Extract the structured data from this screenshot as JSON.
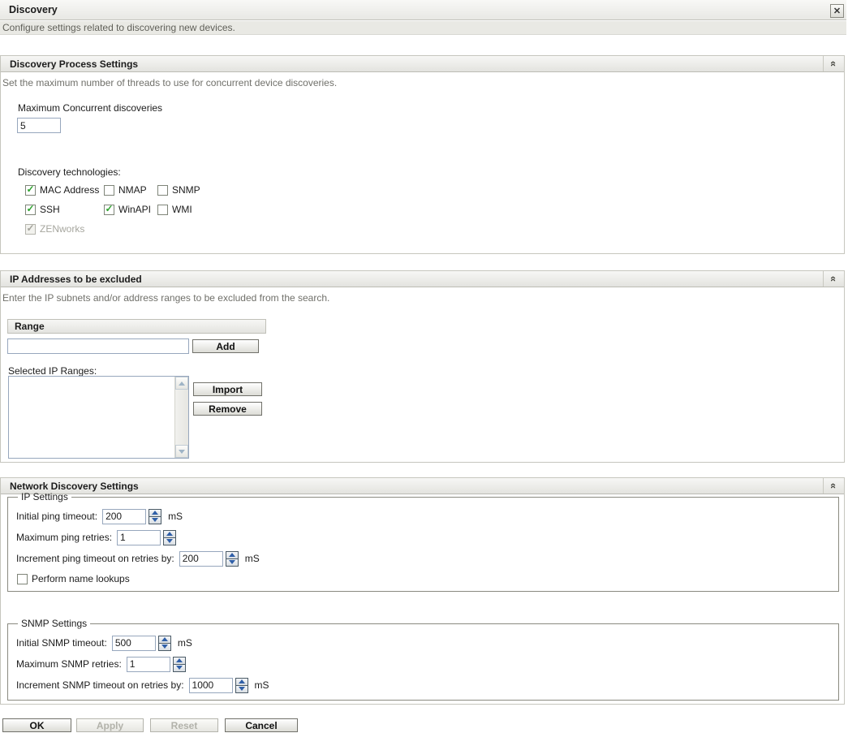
{
  "ui": {
    "check_glyph": "✓",
    "collapse_glyph": "«",
    "close_glyph": "✕"
  },
  "colors": {
    "check_green": "#2da32d",
    "spinner_blue": "#2f5fa8",
    "panel_header_bg": "#ececе8",
    "subtitle_bg": "#e9e9e4"
  },
  "dialog": {
    "title": "Discovery",
    "subtitle": "Configure settings related to discovering new devices."
  },
  "panels": {
    "process": {
      "title": "Discovery Process Settings",
      "description": "Set the maximum number of threads to use for concurrent device discoveries.",
      "max_concurrent_label": "Maximum Concurrent discoveries",
      "max_concurrent_value": "5",
      "technologies_label": "Discovery technologies:",
      "technologies": [
        {
          "label": "MAC Address",
          "checked": true,
          "disabled": false
        },
        {
          "label": "NMAP",
          "checked": false,
          "disabled": false
        },
        {
          "label": "SNMP",
          "checked": false,
          "disabled": false
        },
        {
          "label": "SSH",
          "checked": true,
          "disabled": false
        },
        {
          "label": "WinAPI",
          "checked": true,
          "disabled": false
        },
        {
          "label": "WMI",
          "checked": false,
          "disabled": false
        },
        {
          "label": "ZENworks",
          "checked": true,
          "disabled": true
        }
      ]
    },
    "excluded": {
      "title": "IP Addresses to be excluded",
      "description": "Enter the IP subnets and/or address ranges to be excluded from the search.",
      "range_header": "Range",
      "range_value": "",
      "add_label": "Add",
      "selected_label": "Selected IP Ranges:",
      "selected_items": [],
      "import_label": "Import",
      "remove_label": "Remove"
    },
    "network": {
      "title": "Network Discovery Settings",
      "ip_settings": {
        "legend": "IP Settings",
        "rows": [
          {
            "label": "Initial ping timeout:",
            "value": "200",
            "unit": "mS"
          },
          {
            "label": "Maximum ping retries:",
            "value": "1",
            "unit": ""
          },
          {
            "label": "Increment ping timeout on retries by:",
            "value": "200",
            "unit": "mS"
          }
        ],
        "lookup_checkbox": {
          "label": "Perform name lookups",
          "checked": false,
          "disabled": false
        }
      },
      "snmp_settings": {
        "legend": "SNMP Settings",
        "rows": [
          {
            "label": "Initial SNMP timeout:",
            "value": "500",
            "unit": "mS"
          },
          {
            "label": "Maximum SNMP retries:",
            "value": "1",
            "unit": ""
          },
          {
            "label": "Increment SNMP timeout on retries by:",
            "value": "1000",
            "unit": "mS"
          }
        ]
      }
    }
  },
  "footer": {
    "buttons": [
      {
        "label": "OK",
        "disabled": false
      },
      {
        "label": "Apply",
        "disabled": true
      },
      {
        "label": "Reset",
        "disabled": true
      },
      {
        "label": "Cancel",
        "disabled": false
      }
    ]
  }
}
